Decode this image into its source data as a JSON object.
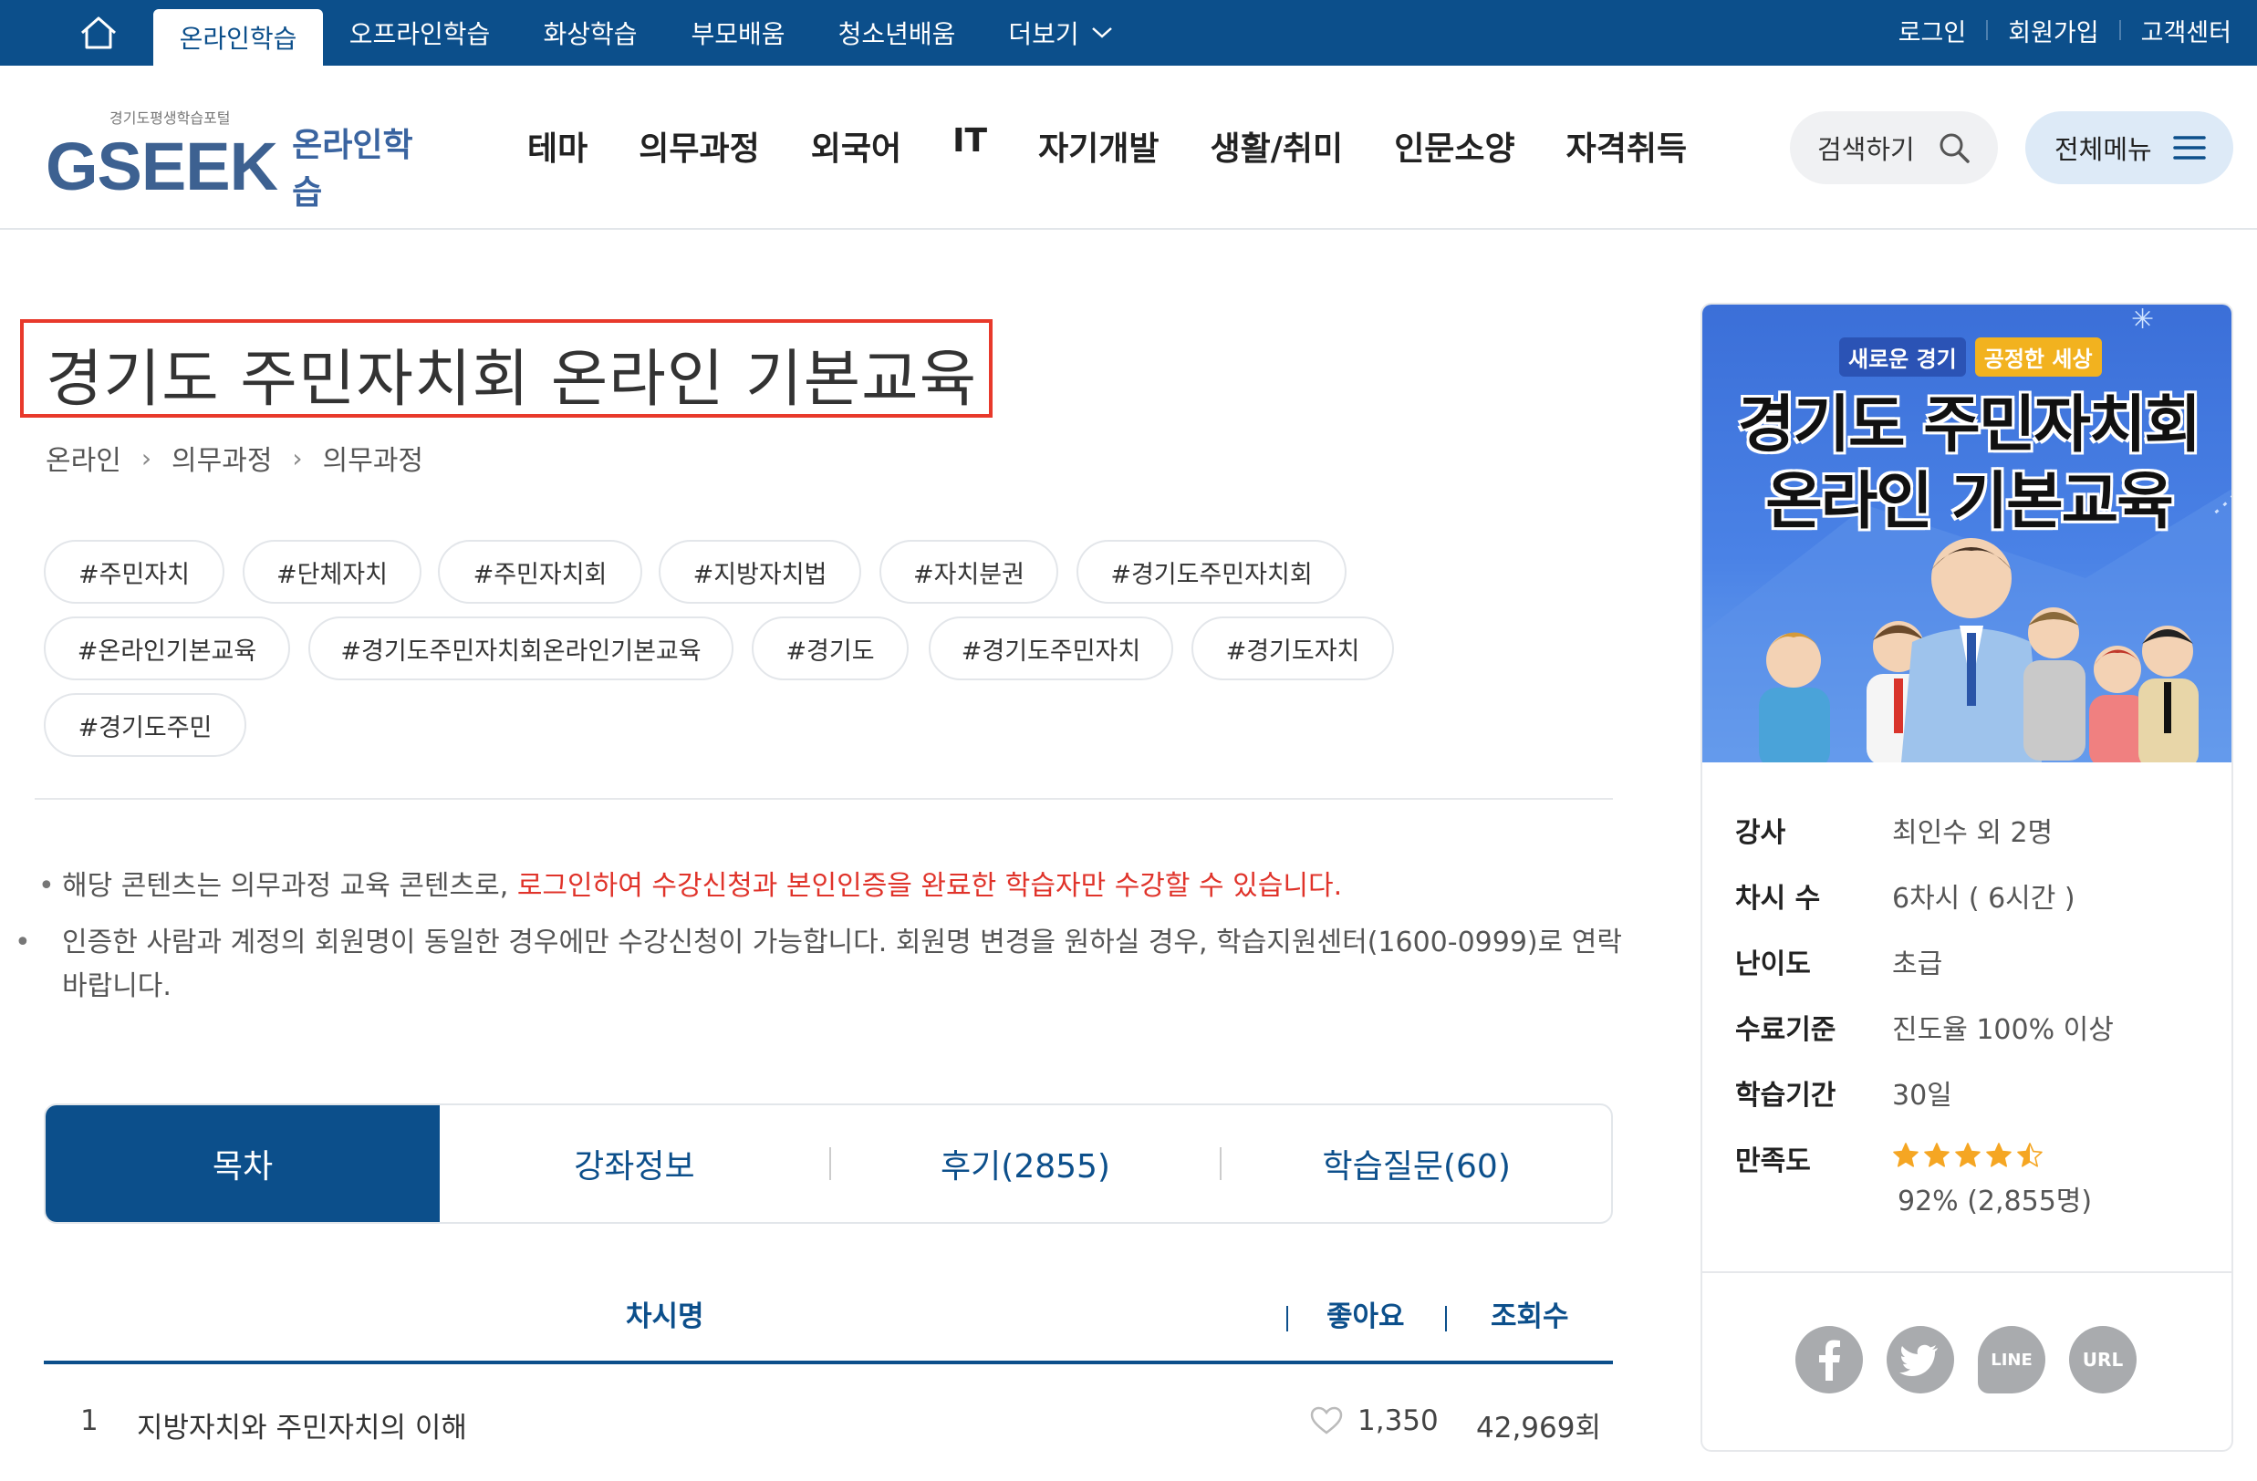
{
  "top_tabs": [
    "온라인학습",
    "오프라인학습",
    "화상학습",
    "부모배움",
    "청소년배움",
    "더보기"
  ],
  "top_right": {
    "login": "로그인",
    "signup": "회원가입",
    "support": "고객센터"
  },
  "logo": {
    "sub": "경기도평생학습포털",
    "brand": "GSEEK",
    "online": "온라인학습"
  },
  "nav": [
    "테마",
    "의무과정",
    "외국어",
    "IT",
    "자기개발",
    "생활/취미",
    "인문소양",
    "자격취득"
  ],
  "search_label": "검색하기",
  "menu_label": "전체메뉴",
  "course": {
    "title": "경기도 주민자치회 온라인 기본교육",
    "breadcrumb": [
      "온라인",
      "의무과정",
      "의무과정"
    ],
    "tags": [
      "#주민자치",
      "#단체자치",
      "#주민자치회",
      "#지방자치법",
      "#자치분권",
      "#경기도주민자치회",
      "#온라인기본교육",
      "#경기도주민자치회온라인기본교육",
      "#경기도",
      "#경기도주민자치",
      "#경기도자치",
      "#경기도주민"
    ]
  },
  "notices": {
    "n1_plain": "해당 콘텐츠는 의무과정 교육 콘텐츠로, ",
    "n1_red": "로그인하여 수강신청과 본인인증을 완료한 학습자만 수강할 수 있습니다.",
    "n2": "인증한 사람과 계정의 회원명이 동일한 경우에만 수강신청이 가능합니다. 회원명 변경을 원하실 경우, 학습지원센터(1600-0999)로 연락바랍니다."
  },
  "tabs": [
    "목차",
    "강좌정보",
    "후기(2855)",
    "학습질문(60)"
  ],
  "table": {
    "headers": {
      "name": "차시명",
      "likes": "좋아요",
      "views": "조회수"
    },
    "rows": [
      {
        "num": "1",
        "name": "지방자치와 주민자치의 이해",
        "likes": "1,350",
        "views": "42,969회"
      }
    ]
  },
  "thumbnail": {
    "slogan1": "새로운 경기",
    "slogan2": "공정한 세상",
    "line1": "경기도 주민자치회",
    "line2": "온라인 기본교육"
  },
  "info": {
    "instructor_k": "강사",
    "instructor_v": "최인수 외 2명",
    "sessions_k": "차시 수",
    "sessions_v": "6차시 ( 6시간 )",
    "level_k": "난이도",
    "level_v": "초급",
    "complete_k": "수료기준",
    "complete_v": "진도율 100% 이상",
    "period_k": "학습기간",
    "period_v": "30일",
    "satisfaction_k": "만족도",
    "rating_stars": 4.5,
    "rating_text": "92% (2,855명)"
  },
  "share": {
    "line": "LINE",
    "url": "URL"
  },
  "colors": {
    "primary": "#0c4f8b",
    "highlight": "#e8392b",
    "star": "#f5a623"
  }
}
